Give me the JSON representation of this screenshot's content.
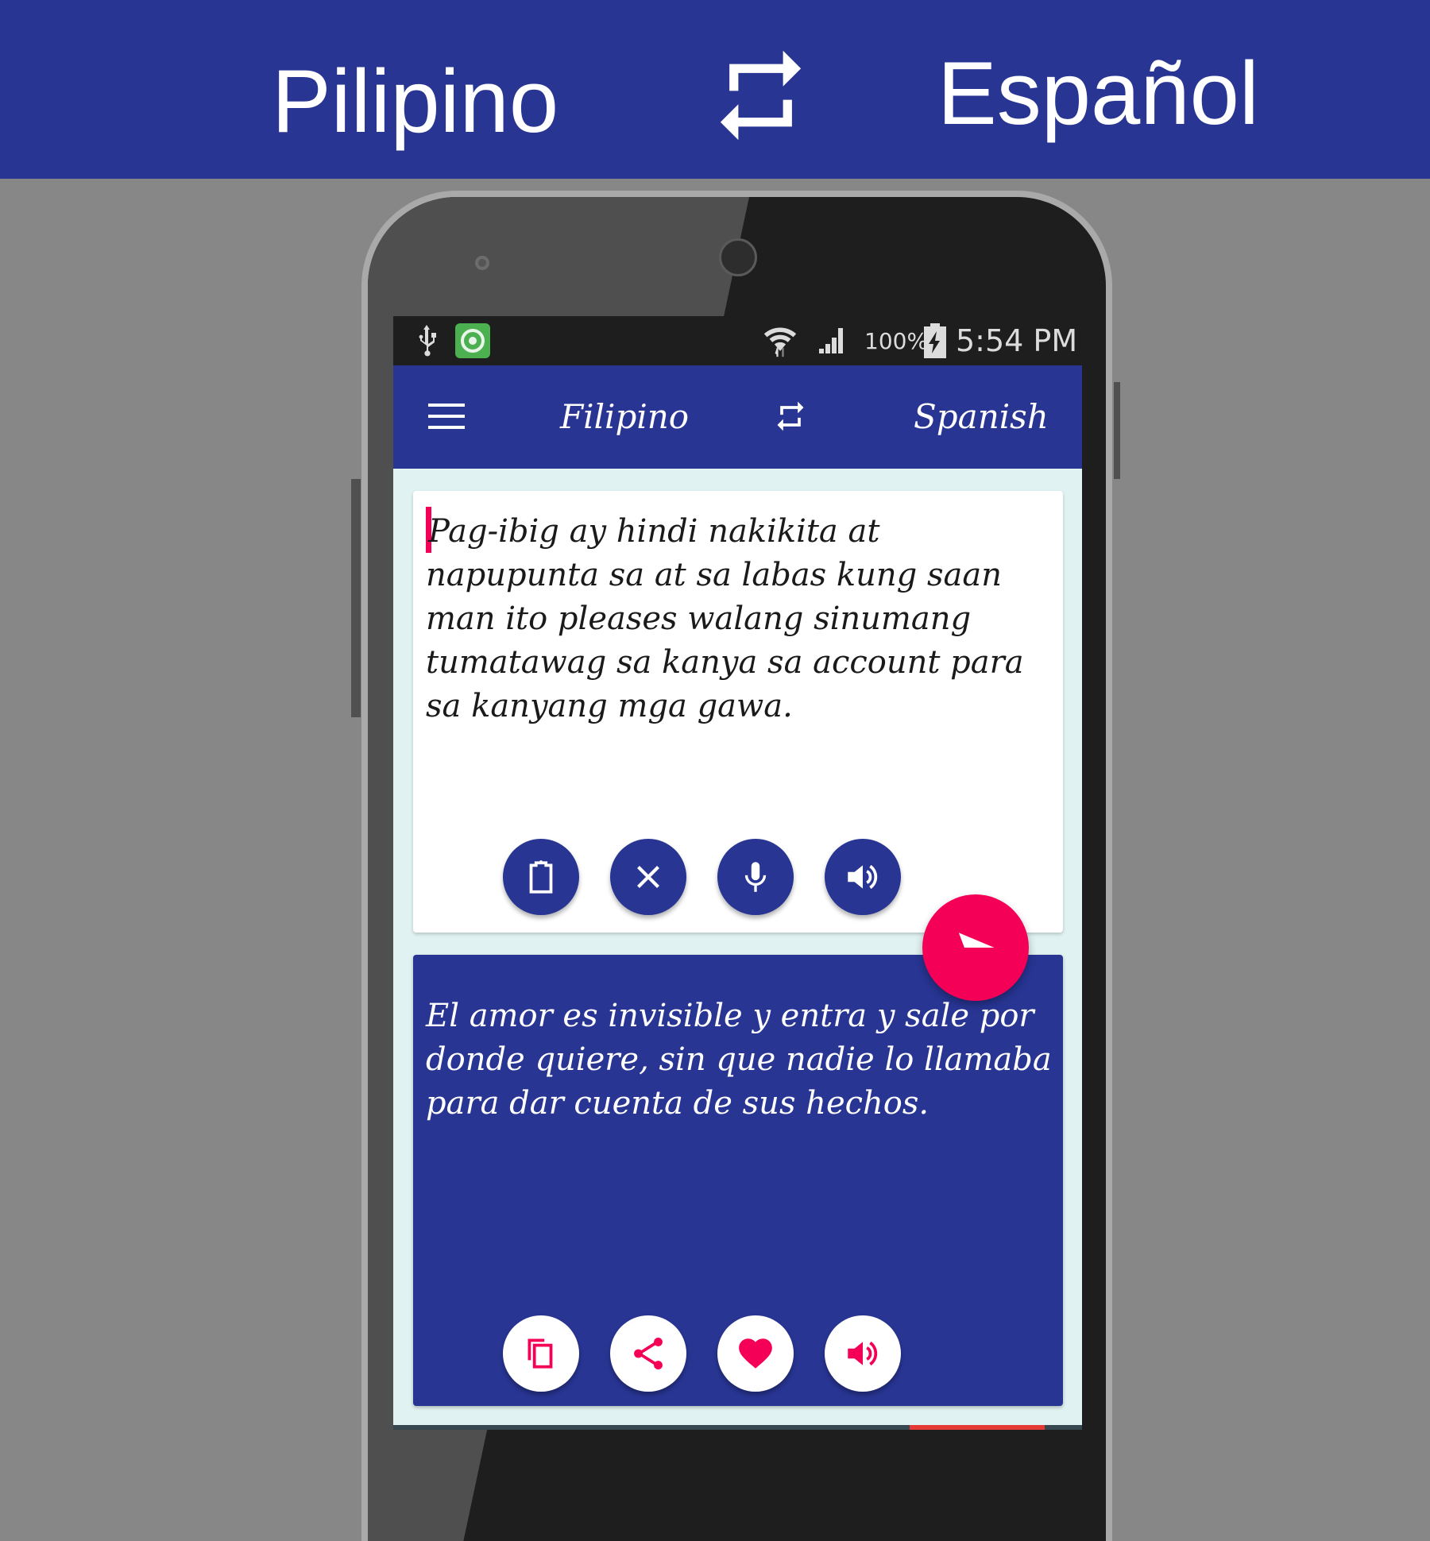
{
  "banner": {
    "source_language": "Pilipino",
    "target_language": "Español",
    "swap_icon": "swap-arrows-icon"
  },
  "status_bar": {
    "left_icons": [
      "usb-icon",
      "app-notification-icon"
    ],
    "right_icons": [
      "wifi-icon",
      "signal-icon",
      "battery-charging-icon"
    ],
    "battery_percent": "100%",
    "time": "5:54 PM"
  },
  "app_bar": {
    "menu_icon": "hamburger-menu-icon",
    "source_language": "Filipino",
    "swap_icon": "swap-arrows-icon",
    "target_language": "Spanish"
  },
  "input": {
    "text": "Pag-ibig ay hindi nakikita at napupunta sa at sa labas kung saan man ito pleases walang sinumang tumatawag sa kanya sa account para sa kanyang mga gawa.",
    "actions": [
      {
        "name": "paste",
        "icon": "clipboard-icon"
      },
      {
        "name": "clear",
        "icon": "close-icon"
      },
      {
        "name": "voice-input",
        "icon": "microphone-icon"
      },
      {
        "name": "speak-input",
        "icon": "speaker-icon"
      }
    ]
  },
  "translate_button": {
    "icon": "send-icon"
  },
  "output": {
    "text": "El amor es invisible y entra y sale por donde quiere, sin que nadie lo llamaba para dar cuenta de sus hechos.",
    "actions": [
      {
        "name": "copy",
        "icon": "copy-icon"
      },
      {
        "name": "share",
        "icon": "share-icon"
      },
      {
        "name": "favorite",
        "icon": "heart-icon"
      },
      {
        "name": "speak-output",
        "icon": "speaker-icon"
      }
    ]
  },
  "colors": {
    "primary": "#283593",
    "accent": "#f50057",
    "background": "#e0f2f1",
    "page_background": "#878787"
  }
}
